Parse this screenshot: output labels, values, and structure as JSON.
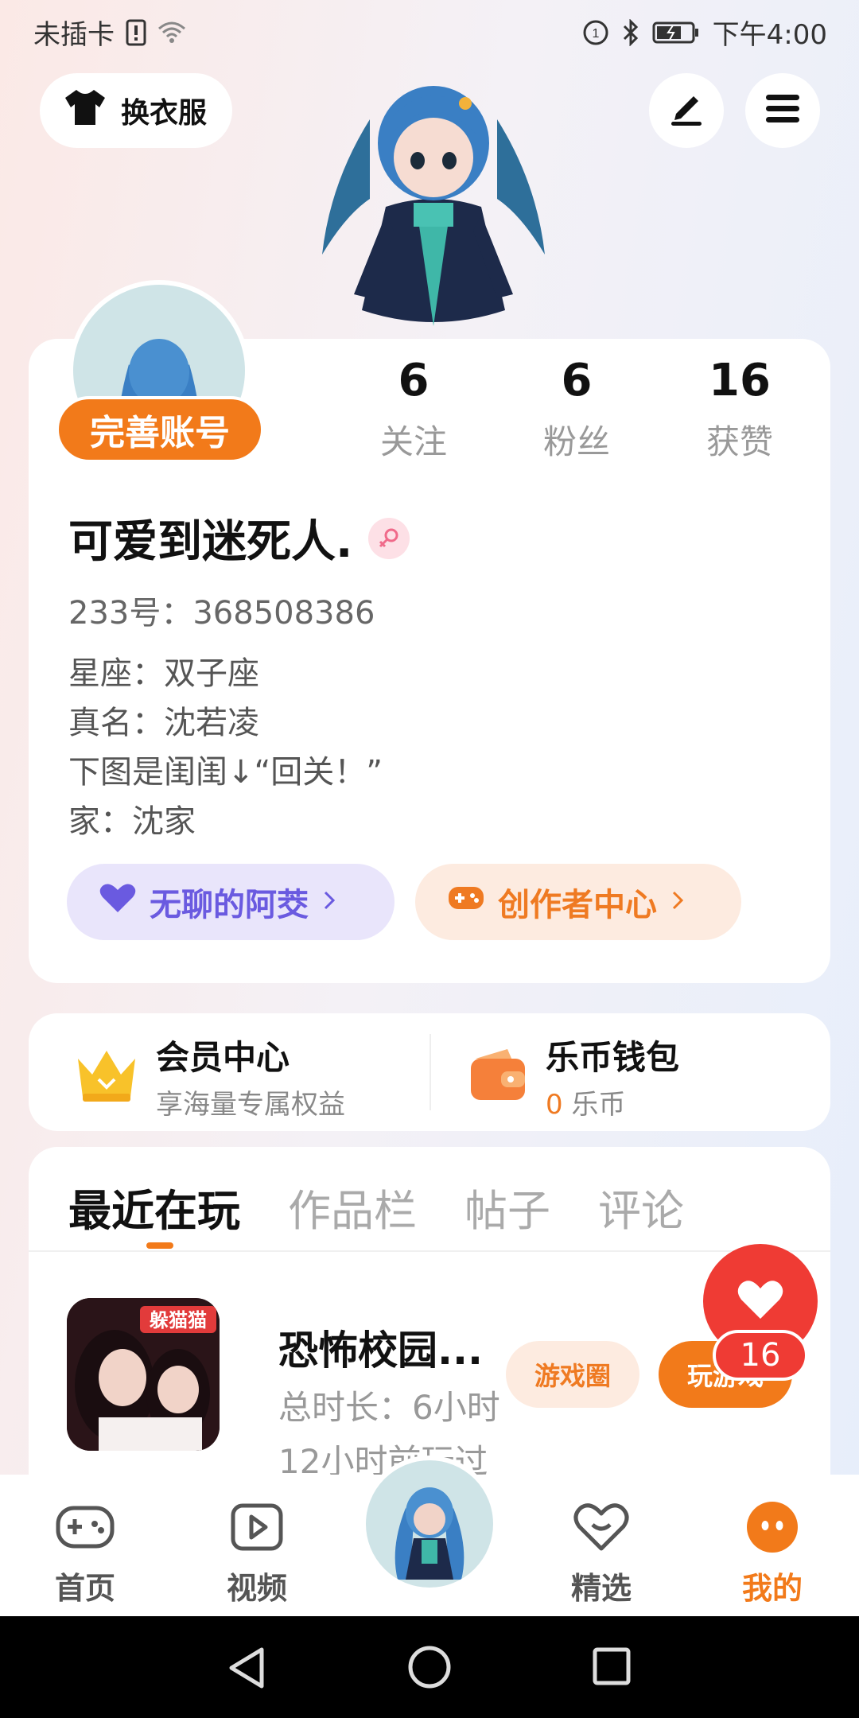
{
  "status_bar": {
    "carrier": "未插卡",
    "time": "下午4:00"
  },
  "top": {
    "change_clothes_label": "换衣服"
  },
  "profile": {
    "complete_account_label": "完善账号",
    "stats": [
      {
        "value": "6",
        "label": "关注"
      },
      {
        "value": "6",
        "label": "粉丝"
      },
      {
        "value": "16",
        "label": "获赞"
      }
    ],
    "username": "可爱到迷死人.",
    "uid": "233号：368508386",
    "bio": [
      "星座：双子座",
      "真名：沈若凌",
      "下图是闺闺↓“回关！”",
      "家：沈家"
    ],
    "pill_left": "无聊的阿茭",
    "pill_right": "创作者中心"
  },
  "member": {
    "vip_title": "会员中心",
    "vip_sub": "享海量专属权益",
    "wallet_title": "乐币钱包",
    "wallet_amount": "0",
    "wallet_unit": "乐币"
  },
  "tabs": [
    "最近在玩",
    "作品栏",
    "帖子",
    "评论"
  ],
  "game": {
    "icon_text": "躲猫猫",
    "name": "恐怖校园...",
    "duration": "总时长：6小时",
    "last_played": "12小时前玩过",
    "circle_btn": "游戏圈",
    "play_btn": "玩游戏"
  },
  "like": {
    "count": "16"
  },
  "bottom_nav": {
    "home": "首页",
    "video": "视频",
    "featured": "精选",
    "mine": "我的"
  },
  "colors": {
    "accent": "#f27a1a",
    "like_red": "#ef3b34",
    "purple": "#6a5ae0"
  }
}
